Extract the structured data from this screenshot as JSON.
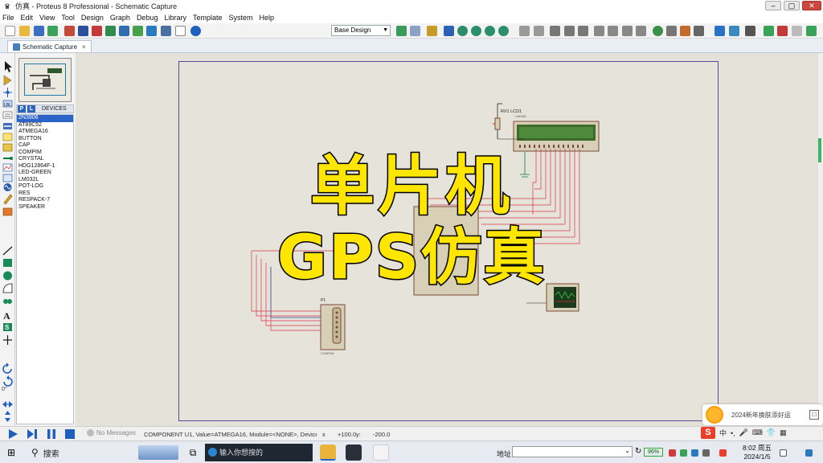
{
  "window": {
    "title": "仿真 - Proteus 8 Professional - Schematic Capture",
    "min": "–",
    "max": "▢",
    "close": "✕"
  },
  "menu": [
    "File",
    "Edit",
    "View",
    "Tool",
    "Design",
    "Graph",
    "Debug",
    "Library",
    "Template",
    "System",
    "Help"
  ],
  "toolbar": {
    "base_design": "Base Design"
  },
  "tab": {
    "label": "Schematic Capture"
  },
  "device_panel": {
    "header_p": "P",
    "header_l": "L",
    "header_label": "DEVICES",
    "devices": [
      "2N3906",
      "AT89C52",
      "ATMEGA16",
      "BUTTON",
      "CAP",
      "COMPIM",
      "CRYSTAL",
      "HDG12864F-1",
      "LED-GREEN",
      "LM032L",
      "POT-LOG",
      "RES",
      "RESPACK-7",
      "SPEAKER"
    ],
    "selected_index": 0
  },
  "left_tools": {
    "rotation_readout": "0°"
  },
  "schematic": {
    "lcd_label": "RV1  LCD1",
    "lcd_part": "LM032L",
    "port_label": "P1",
    "port_part": "COMPIM"
  },
  "overlay": {
    "line1": "单片机",
    "line2": "GPS仿真"
  },
  "status": {
    "messages": "No Messages",
    "component_text": "COMPONENT U1, Value=ATMEGA16, Module=<NONE>, Device=A",
    "x_label": "x",
    "x_value": "+100.0",
    "y_label": "y:",
    "y_value": "-200.0"
  },
  "notification": {
    "text": "2024新年换肤添好运",
    "button": "□"
  },
  "ime": {
    "logo": "S",
    "mode": "中"
  },
  "taskbar": {
    "search_label": "搜索",
    "search_placeholder": "输入你想搜的",
    "address_label": "地址",
    "battery": "96%",
    "time": "8:02 周五",
    "date": "2024/1/5"
  },
  "colors": {
    "accent_blue": "#2a64c8",
    "overlay_text": "#ffe600",
    "wire_red": "#d9364b",
    "lcd_green": "#3c6b2c"
  }
}
